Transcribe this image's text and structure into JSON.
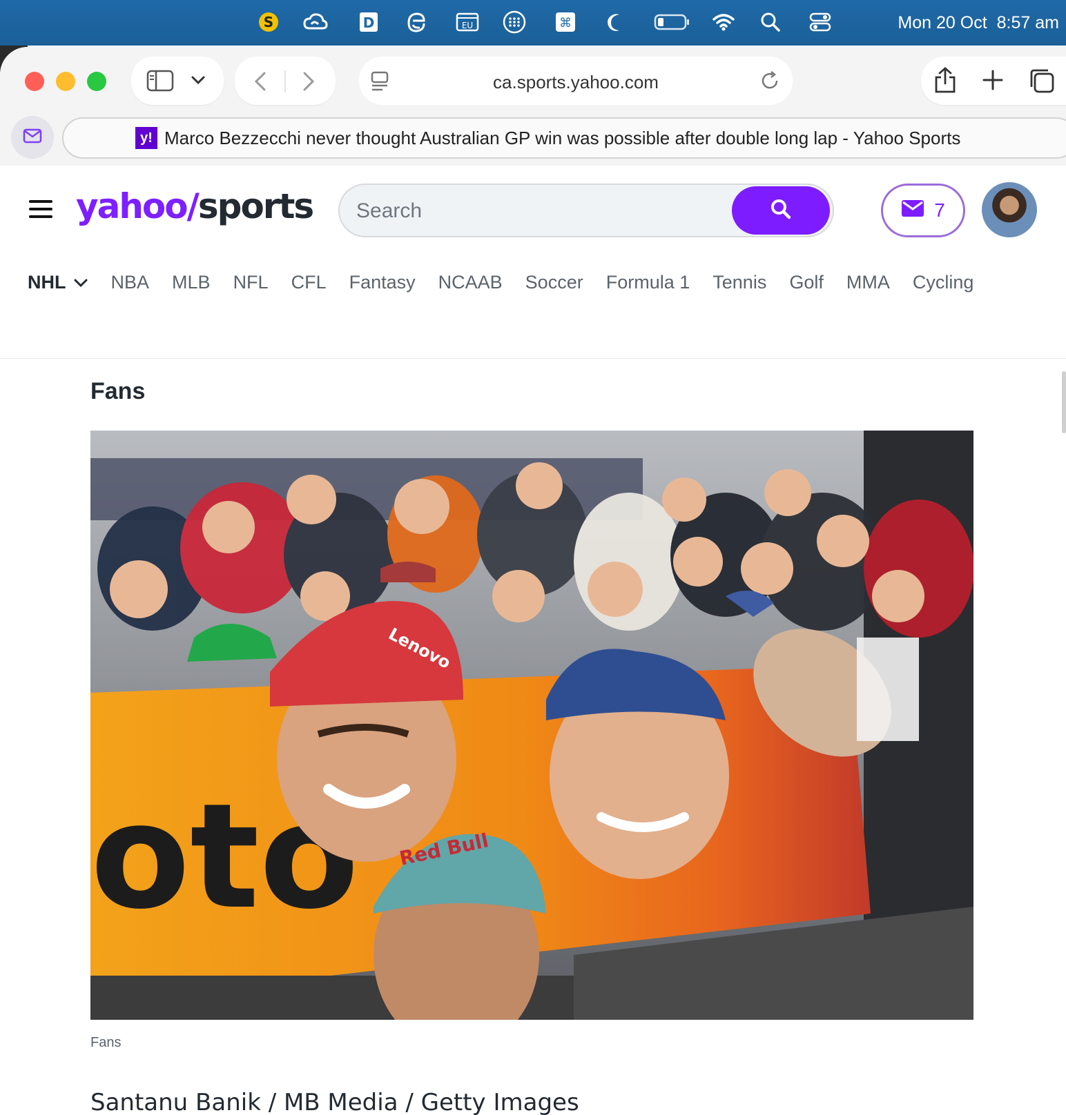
{
  "menubar": {
    "date": "Mon 20 Oct",
    "time": "8:57 am",
    "icons": [
      "scrooge-icon",
      "creative-cloud-icon",
      "dictionary-icon",
      "edge-icon",
      "eu-vat-icon",
      "launchpad-icon",
      "keyboard-shortcut-icon",
      "moon-icon",
      "battery-icon",
      "wifi-icon",
      "spotlight-icon",
      "control-center-icon"
    ]
  },
  "browser": {
    "url": "ca.sports.yahoo.com",
    "tab_favicon": "y!",
    "tab_title": "Marco Bezzecchi never thought Australian GP win was possible after double long lap - Yahoo Sports"
  },
  "header": {
    "logo_yahoo": "yahoo",
    "logo_slash": "/",
    "logo_sports": "sports",
    "search_placeholder": "Search",
    "mail_count": "7",
    "accent": "#7d1cff"
  },
  "nav": {
    "active": "NHL",
    "items": [
      "NBA",
      "MLB",
      "NFL",
      "CFL",
      "Fantasy",
      "NCAAB",
      "Soccer",
      "Formula 1",
      "Tennis",
      "Golf",
      "MMA",
      "Cycling"
    ]
  },
  "article": {
    "section_title": "Fans",
    "photo_caption": "Fans",
    "photo_credit": "Santanu Banik / MB Media / Getty Images",
    "photo_text_banner": "oto",
    "photo_text_cap": "Lenovo",
    "photo_text_cap2": "Red Bull"
  }
}
